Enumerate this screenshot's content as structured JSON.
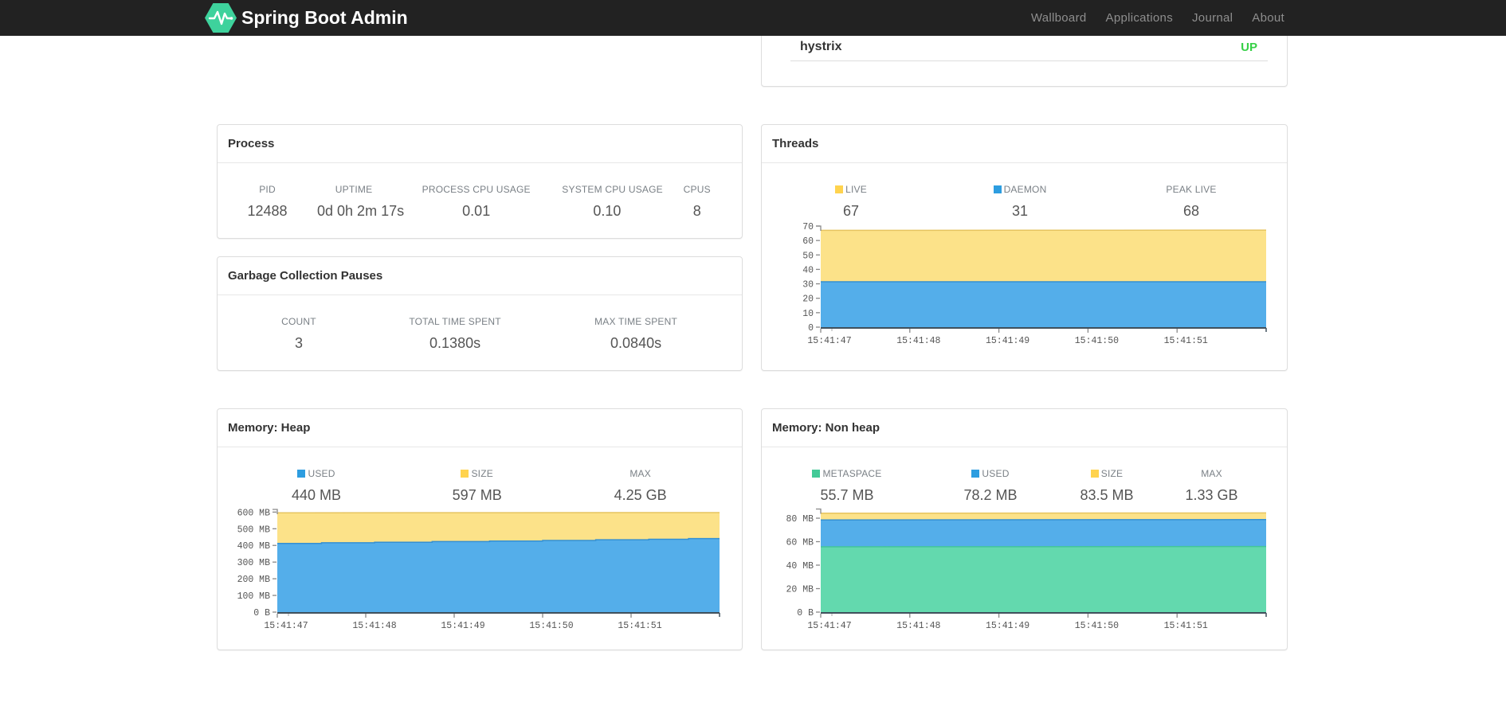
{
  "navbar": {
    "brand": "Spring Boot Admin",
    "links": [
      "Wallboard",
      "Applications",
      "Journal",
      "About"
    ]
  },
  "status_panel": {
    "application": "hystrix",
    "status": "UP",
    "status_color": "#36d046"
  },
  "panels": {
    "process": {
      "title": "Process",
      "metrics": [
        {
          "label": "PID",
          "value": "12488"
        },
        {
          "label": "UPTIME",
          "value": "0d 0h 2m 17s"
        },
        {
          "label": "PROCESS CPU USAGE",
          "value": "0.01"
        },
        {
          "label": "SYSTEM CPU USAGE",
          "value": "0.10"
        },
        {
          "label": "CPUS",
          "value": "8"
        }
      ]
    },
    "gc": {
      "title": "Garbage Collection Pauses",
      "metrics": [
        {
          "label": "COUNT",
          "value": "3"
        },
        {
          "label": "TOTAL TIME SPENT",
          "value": "0.1380s"
        },
        {
          "label": "MAX TIME SPENT",
          "value": "0.0840s"
        }
      ]
    },
    "threads": {
      "title": "Threads",
      "metrics": [
        {
          "label": "LIVE",
          "value": "67",
          "square": "#ffd34e"
        },
        {
          "label": "DAEMON",
          "value": "31",
          "square": "#2d9de0"
        },
        {
          "label": "PEAK LIVE",
          "value": "68"
        }
      ]
    },
    "heap": {
      "title": "Memory: Heap",
      "metrics": [
        {
          "label": "USED",
          "value": "440 MB",
          "square": "#2d9de0"
        },
        {
          "label": "SIZE",
          "value": "597 MB",
          "square": "#ffd34e"
        },
        {
          "label": "MAX",
          "value": "4.25 GB"
        }
      ]
    },
    "nonheap": {
      "title": "Memory: Non heap",
      "metrics": [
        {
          "label": "METASPACE",
          "value": "55.7 MB",
          "square": "#43ca97"
        },
        {
          "label": "USED",
          "value": "78.2 MB",
          "square": "#2d9de0"
        },
        {
          "label": "SIZE",
          "value": "83.5 MB",
          "square": "#ffd34e"
        },
        {
          "label": "MAX",
          "value": "1.33 GB"
        }
      ]
    }
  },
  "chart_data": [
    {
      "id": "threads-chart",
      "type": "area",
      "title": "Threads",
      "x_tick_labels": [
        "15:41:47",
        "15:41:48",
        "15:41:49",
        "15:41:50",
        "15:41:51"
      ],
      "ylim": [
        0,
        70
      ],
      "y_ticks": [
        {
          "v": 0,
          "label": "0"
        },
        {
          "v": 10,
          "label": "10"
        },
        {
          "v": 20,
          "label": "20"
        },
        {
          "v": 30,
          "label": "30"
        },
        {
          "v": 40,
          "label": "40"
        },
        {
          "v": 50,
          "label": "50"
        },
        {
          "v": 60,
          "label": "60"
        },
        {
          "v": 70,
          "label": "70"
        }
      ],
      "series": [
        {
          "name": "DAEMON",
          "fill": "#54aeea",
          "stroke": "#3590d2",
          "points": [
            [
              0,
              31.4
            ],
            [
              1,
              31.4
            ]
          ]
        },
        {
          "name": "LIVE",
          "fill": "#fce289",
          "stroke": "#e6c45f",
          "points": [
            [
              0,
              67
            ],
            [
              1,
              67.2
            ]
          ]
        }
      ]
    },
    {
      "id": "heap-chart",
      "type": "area",
      "title": "Memory: Heap",
      "x_tick_labels": [
        "15:41:47",
        "15:41:48",
        "15:41:49",
        "15:41:50",
        "15:41:51"
      ],
      "ylim": [
        0,
        616
      ],
      "y_ticks": [
        {
          "v": 0,
          "label": "0 B"
        },
        {
          "v": 100,
          "label": "100 MB"
        },
        {
          "v": 200,
          "label": "200 MB"
        },
        {
          "v": 300,
          "label": "300 MB"
        },
        {
          "v": 400,
          "label": "400 MB"
        },
        {
          "v": 500,
          "label": "500 MB"
        },
        {
          "v": 600,
          "label": "600 MB"
        }
      ],
      "series": [
        {
          "name": "USED",
          "fill": "#54aeea",
          "stroke": "#3590d2",
          "points": [
            [
              0,
              412
            ],
            [
              0.1,
              412
            ],
            [
              0.1,
              416
            ],
            [
              0.22,
              416
            ],
            [
              0.22,
              419
            ],
            [
              0.35,
              419
            ],
            [
              0.35,
              423
            ],
            [
              0.48,
              423
            ],
            [
              0.48,
              426
            ],
            [
              0.6,
              426
            ],
            [
              0.6,
              430
            ],
            [
              0.72,
              430
            ],
            [
              0.72,
              434
            ],
            [
              0.84,
              434
            ],
            [
              0.84,
              437
            ],
            [
              0.93,
              437
            ],
            [
              0.93,
              441
            ],
            [
              1,
              441
            ]
          ]
        },
        {
          "name": "SIZE",
          "fill": "#fce289",
          "stroke": "#e6c45f",
          "points": [
            [
              0,
              596
            ],
            [
              1,
              597
            ]
          ]
        }
      ]
    },
    {
      "id": "nonheap-chart",
      "type": "area",
      "title": "Memory: Non heap",
      "x_tick_labels": [
        "15:41:47",
        "15:41:48",
        "15:41:49",
        "15:41:50",
        "15:41:51"
      ],
      "ylim": [
        0,
        87.8
      ],
      "y_ticks": [
        {
          "v": 0,
          "label": "0 B"
        },
        {
          "v": 20,
          "label": "20 MB"
        },
        {
          "v": 40,
          "label": "40 MB"
        },
        {
          "v": 60,
          "label": "60 MB"
        },
        {
          "v": 80,
          "label": "80 MB"
        }
      ],
      "series": [
        {
          "name": "METASPACE",
          "fill": "#63d9ae",
          "stroke": "#43c59a",
          "points": [
            [
              0,
              55.6
            ],
            [
              1,
              55.9
            ]
          ]
        },
        {
          "name": "USED",
          "fill": "#54aeea",
          "stroke": "#3590d2",
          "points": [
            [
              0,
              78.5
            ],
            [
              1,
              78.8
            ]
          ]
        },
        {
          "name": "SIZE",
          "fill": "#fce289",
          "stroke": "#e6c45f",
          "points": [
            [
              0,
              84.2
            ],
            [
              1,
              84.5
            ]
          ]
        }
      ]
    }
  ]
}
